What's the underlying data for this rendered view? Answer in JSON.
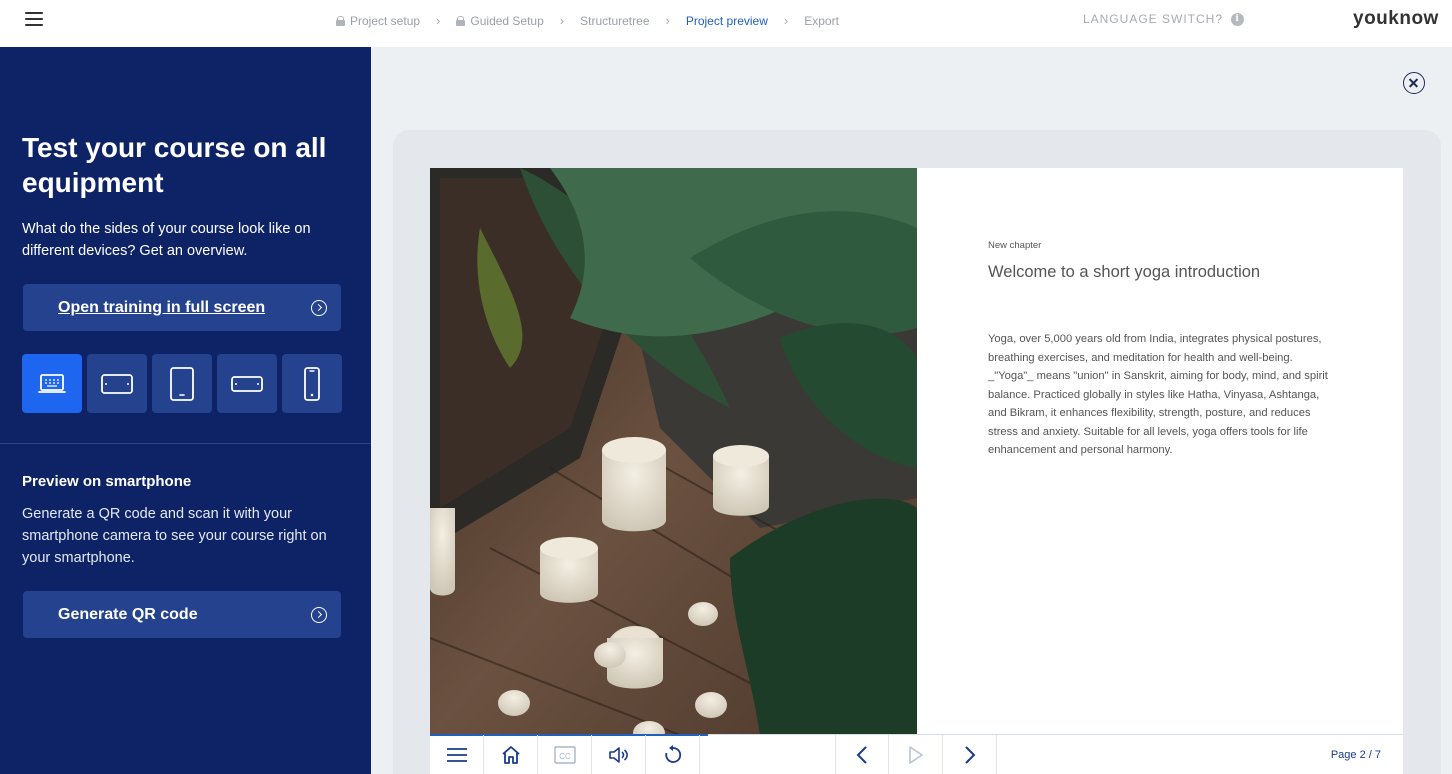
{
  "topbar": {
    "breadcrumbs": [
      {
        "label": "Project setup",
        "locked": true
      },
      {
        "label": "Guided Setup",
        "locked": true
      },
      {
        "label": "Structuretree",
        "locked": false
      },
      {
        "label": "Project preview",
        "locked": false,
        "active": true
      },
      {
        "label": "Export",
        "locked": false
      }
    ],
    "language_switch": "LANGUAGE SWITCH?",
    "logo": "youknow"
  },
  "sidebar": {
    "title": "Test your course on all equipment",
    "description": "What do the sides of your course look like on different devices? Get an overview.",
    "fullscreen_button": "Open training in full screen",
    "devices": [
      {
        "name": "desktop",
        "active": true
      },
      {
        "name": "tablet-landscape",
        "active": false
      },
      {
        "name": "tablet-portrait",
        "active": false
      },
      {
        "name": "phone-landscape",
        "active": false
      },
      {
        "name": "phone-portrait",
        "active": false
      }
    ],
    "smartphone_heading": "Preview on smartphone",
    "smartphone_text": "Generate a QR code and scan it with your smartphone camera to see your course right on your smartphone.",
    "qr_button": "Generate QR code"
  },
  "slide": {
    "chapter": "New chapter",
    "title": "Welcome to a short yoga introduction",
    "body": "Yoga, over 5,000 years old from India, integrates physical postures, breathing exercises, and meditation for health and well-being. _\"Yoga\"_ means \"union\" in Sanskrit, aiming for body, mind, and spirit balance. Practiced globally in styles like Hatha, Vinyasa, Ashtanga, and Bikram, it enhances flexibility, strength, posture, and reduces stress and anxiety. Suitable for all levels, yoga offers tools for life enhancement and personal harmony."
  },
  "player": {
    "page_indicator": "Page 2 / 7",
    "progress_fraction": 0.2857,
    "controls": [
      "menu-icon",
      "home-icon",
      "captions-icon",
      "volume-icon",
      "replay-icon",
      "previous-icon",
      "play-icon",
      "next-icon"
    ]
  },
  "colors": {
    "sidebar_bg": "#0d2366",
    "button_bg": "#25428f",
    "accent_blue": "#1e66f0",
    "link_blue": "#1f5fbf",
    "main_bg": "#edf0f3"
  }
}
